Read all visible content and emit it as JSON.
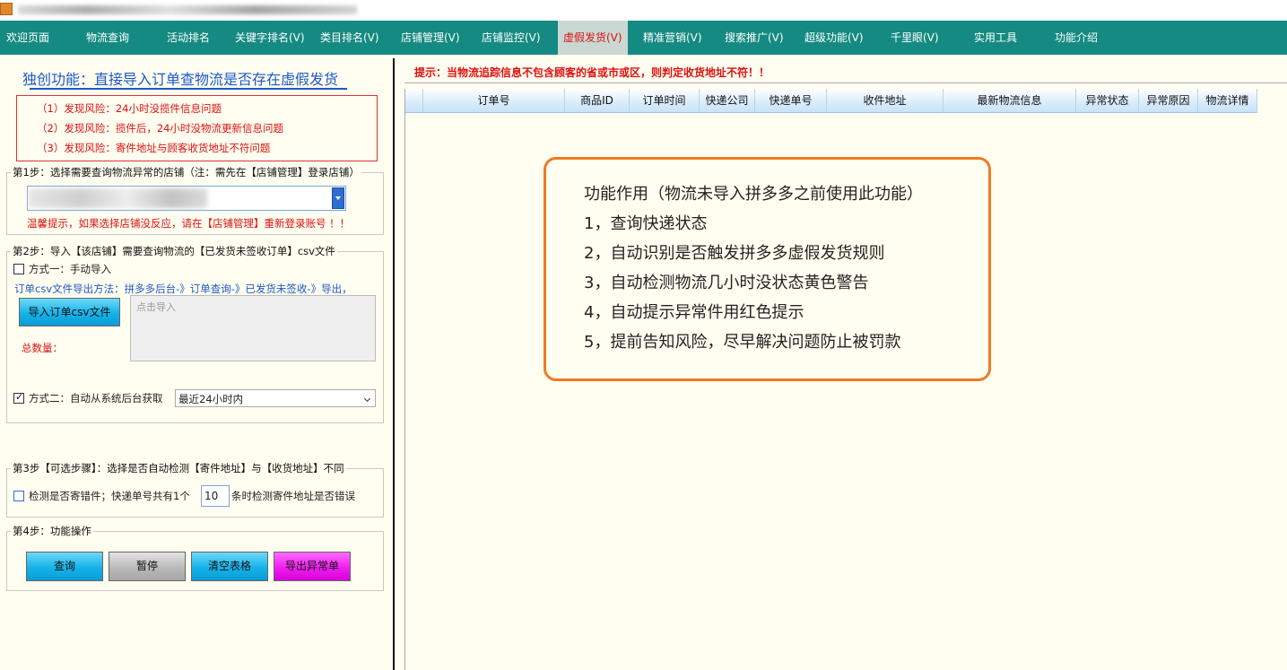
{
  "menu": [
    "欢迎页面",
    "物流查询",
    "活动排名",
    "关键字排名(V)",
    "类目排名(V)",
    "店铺管理(V)",
    "店铺监控(V)",
    "虚假发货(V)",
    "精准营销(V)",
    "搜索推广(V)",
    "超级功能(V)",
    "千里眼(V)",
    "实用工具",
    "功能介绍"
  ],
  "left": {
    "heading": "独创功能：直接导入订单查物流是否存在虚假发货",
    "risks": [
      "（1）发现风险：24小时没揽件信息问题",
      "（2）发现风险：揽件后，24小时没物流更新信息问题",
      "（3）发现风险：寄件地址与顾客收货地址不符问题"
    ],
    "step1": {
      "title": "第1步：选择需要查询物流异常的店铺（注：需先在【店铺管理】登录店铺）",
      "warning": "温馨提示，如果选择店铺没反应，请在【店铺管理】重新登录账号  ！！"
    },
    "step2": {
      "title": "第2步：导入【该店铺】需要查询物流的【已发货未签收订单】csv文件",
      "method1": "方式一：手动导入",
      "export_path": "订单csv文件导出方法：拼多多后台-》订单查询-》已发货未签收-》导出，",
      "import_button": "导入订单csv文件",
      "import_placeholder": "点击导入",
      "total_label": "总数量：",
      "method2": "方式二：自动从系统后台获取",
      "range_selected": "最近24小时内"
    },
    "step3": {
      "title": "第3步【可选步骤】：选择是否自动检测【寄件地址】与【收货地址】不同",
      "check_prefix": "检测是否寄错件；快递单号共有1个",
      "count_value": "10",
      "check_suffix": "条时检测寄件地址是否错误"
    },
    "step4": {
      "title": "第4步：功能操作",
      "buttons": [
        "查询",
        "暂停",
        "清空表格",
        "导出异常单"
      ]
    }
  },
  "right": {
    "hint": "提示：当物流追踪信息不包含顾客的省或市或区，则判定收货地址不符！！",
    "columns": [
      "订单号",
      "商品ID",
      "订单时间",
      "快递公司",
      "快递单号",
      "收件地址",
      "最新物流信息",
      "异常状态",
      "异常原因",
      "物流详情"
    ],
    "info": [
      "功能作用（物流未导入拼多多之前使用此功能）",
      "1，查询快递状态",
      "2，自动识别是否触发拼多多虚假发货规则",
      "3，自动检测物流几小时没状态黄色警告",
      "4，自动提示异常件用红色提示",
      "5，提前告知风险，尽早解决问题防止被罚款"
    ]
  },
  "colors": {
    "menubar": "#148a82",
    "accent": "#1d58c8",
    "warning": "#d11111",
    "info_border": "#f07a22"
  }
}
